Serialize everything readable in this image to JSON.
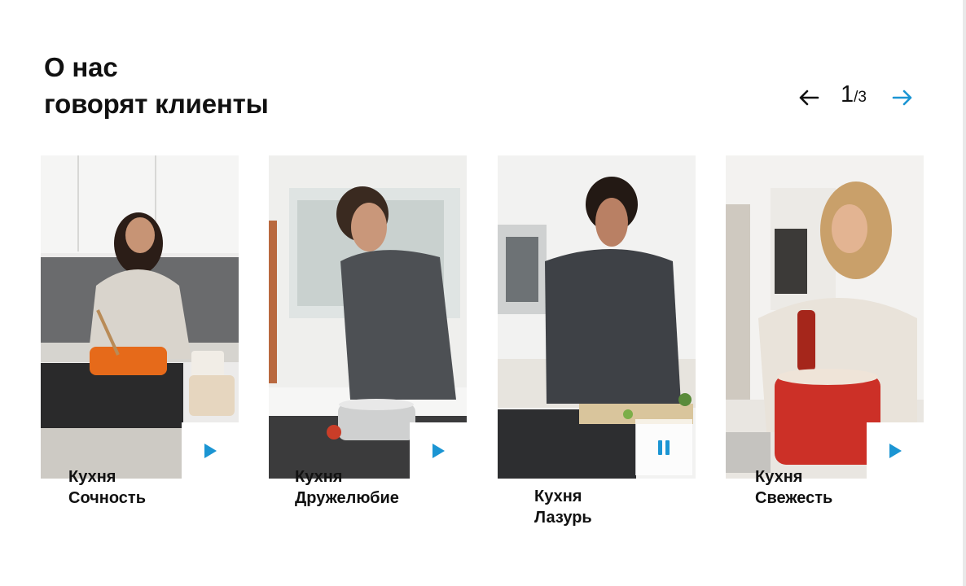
{
  "section": {
    "title_line1": "О нас",
    "title_line2": "говорят клиенты"
  },
  "pager": {
    "current": "1",
    "total": "/3",
    "prev_icon": "arrow-left-icon",
    "next_icon": "arrow-right-icon"
  },
  "colors": {
    "accent": "#1b95d3",
    "text": "#111111",
    "background": "#ffffff"
  },
  "cards": [
    {
      "line1": "Кухня",
      "line2": "Сочность",
      "state": "paused",
      "icon": "play-icon"
    },
    {
      "line1": "Кухня",
      "line2": "Дружелюбие",
      "state": "paused",
      "icon": "play-icon"
    },
    {
      "line1": "Кухня",
      "line2": "Лазурь",
      "state": "playing",
      "icon": "pause-icon"
    },
    {
      "line1": "Кухня",
      "line2": "Свежесть",
      "state": "paused",
      "icon": "play-icon"
    }
  ]
}
